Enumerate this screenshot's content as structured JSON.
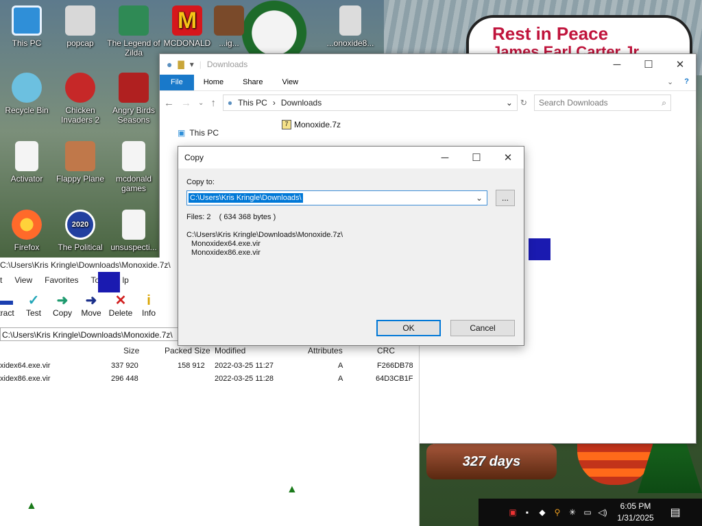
{
  "desktop": {
    "icons": [
      {
        "label": "This PC",
        "icon": "monitor-icon",
        "color": "#2f8fd8"
      },
      {
        "label": "popcap",
        "icon": "popcap-icon",
        "color": "#d8d8d8"
      },
      {
        "label": "The Legend of Zilda",
        "icon": "game-character-icon",
        "color": "#2f8a55"
      },
      {
        "label": "MCDONALD",
        "icon": "mcdonalds-icon",
        "color": "#d6171c"
      },
      {
        "label": "Recycle Bin",
        "icon": "recycle-bin-icon",
        "color": "#6cc0e0"
      },
      {
        "label": "Chicken Invaders 2",
        "icon": "chicken-icon",
        "color": "#c62828"
      },
      {
        "label": "Angry Birds Seasons",
        "icon": "angry-birds-icon",
        "color": "#b02020"
      },
      {
        "label": "Activator",
        "icon": "blank-file-icon",
        "color": "#f4f4f4"
      },
      {
        "label": "Flappy Plane",
        "icon": "flappy-plane-icon",
        "color": "#c0784a"
      },
      {
        "label": "mcdonald games",
        "icon": "blank-file-icon",
        "color": "#f4f4f4"
      },
      {
        "label": "Firefox",
        "icon": "firefox-icon",
        "color": "#ff6a2a"
      },
      {
        "label": "The Political",
        "icon": "political-2020-icon",
        "color": "#2240a0"
      },
      {
        "label": "unsuspecti...",
        "icon": "blank-file-icon",
        "color": "#f4f4f4"
      },
      {
        "label": "...ig...",
        "icon": "reindeer-icon",
        "color": "#7a4a2a"
      },
      {
        "label": "...onoxide8...",
        "icon": "binary-file-icon",
        "color": "#dcdcdc"
      }
    ],
    "sign_line1": "Rest in Peace",
    "sign_line2": "James Earl Carter Jr.",
    "globe_label": "327 days"
  },
  "explorer": {
    "title": "Downloads",
    "ribbon_tabs": [
      "File",
      "Home",
      "Share",
      "View"
    ],
    "breadcrumb": [
      "This PC",
      "Downloads"
    ],
    "search_placeholder": "Search Downloads",
    "nav_item": "This PC",
    "file_name": "Monoxide.7z"
  },
  "copy_dialog": {
    "title": "Copy",
    "copy_to_label": "Copy to:",
    "destination": "C:\\Users\\Kris Kringle\\Downloads\\",
    "browse_label": "...",
    "files_info": "Files: 2    ( 634 368 bytes )",
    "source_path": "C:\\Users\\Kris Kringle\\Downloads\\Monoxide.7z\\",
    "items": [
      "Monoxidex64.exe.vir",
      "Monoxidex86.exe.vir"
    ],
    "ok_label": "OK",
    "cancel_label": "Cancel"
  },
  "sevenzip": {
    "title": "C:\\Users\\Kris Kringle\\Downloads\\Monoxide.7z\\",
    "menu": [
      "t",
      "View",
      "Favorites",
      "Tools",
      "lp"
    ],
    "tools": [
      {
        "label": "tract",
        "icon": "extract-icon",
        "color": "#1a3fb0"
      },
      {
        "label": "Test",
        "icon": "test-icon",
        "color": "#22a6b8"
      },
      {
        "label": "Copy",
        "icon": "copy-icon",
        "color": "#1d9a6e"
      },
      {
        "label": "Move",
        "icon": "move-icon",
        "color": "#1a2f8a"
      },
      {
        "label": "Delete",
        "icon": "delete-icon",
        "color": "#d11f1f"
      },
      {
        "label": "Info",
        "icon": "info-icon",
        "color": "#d9a400"
      }
    ],
    "path": "C:\\Users\\Kris Kringle\\Downloads\\Monoxide.7z\\",
    "columns": [
      "Size",
      "Packed Size",
      "Modified",
      "Attributes",
      "CRC"
    ],
    "rows": [
      {
        "name": "xidex64.exe.vir",
        "size": "337 920",
        "packed": "158 912",
        "modified": "2022-03-25 11:27",
        "attr": "A",
        "crc": "F266DB78"
      },
      {
        "name": "xidex86.exe.vir",
        "size": "296 448",
        "packed": "",
        "modified": "2022-03-25 11:28",
        "attr": "A",
        "crc": "64D3CB1F"
      }
    ]
  },
  "taskbar": {
    "time": "6:05 PM",
    "date": "1/31/2025"
  }
}
